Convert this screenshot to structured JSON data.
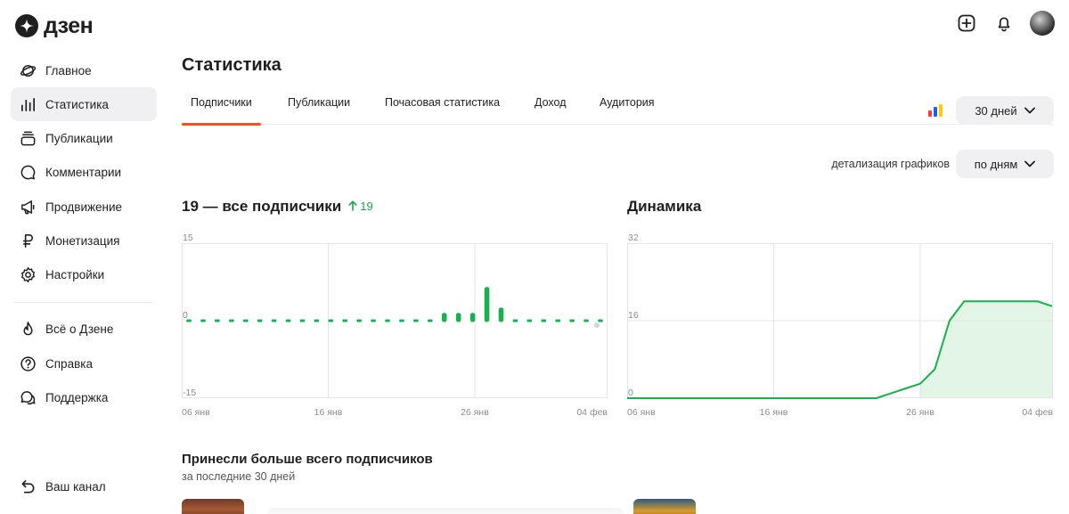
{
  "header": {
    "logo_text": "дзен",
    "icons": {
      "logo": "dzen-star-icon",
      "add": "plus-square-icon",
      "bell": "bell-icon",
      "avatar": "avatar"
    }
  },
  "sidebar": {
    "items": [
      {
        "label": "Главное",
        "icon": "planet-icon"
      },
      {
        "label": "Статистика",
        "icon": "bar-stats-icon",
        "active": true
      },
      {
        "label": "Публикации",
        "icon": "stack-icon"
      },
      {
        "label": "Комментарии",
        "icon": "comment-icon"
      },
      {
        "label": "Продвижение",
        "icon": "megaphone-icon"
      },
      {
        "label": "Монетизация",
        "icon": "ruble-icon"
      },
      {
        "label": "Настройки",
        "icon": "gear-icon"
      }
    ],
    "secondary": [
      {
        "label": "Всё о Дзене",
        "icon": "flame-icon"
      },
      {
        "label": "Справка",
        "icon": "help-icon"
      },
      {
        "label": "Поддержка",
        "icon": "chat-icon"
      }
    ],
    "channel": {
      "label": "Ваш канал",
      "icon": "back-arrow-icon"
    }
  },
  "page": {
    "title": "Статистика",
    "tabs": [
      {
        "label": "Подписчики",
        "active": true
      },
      {
        "label": "Публикации"
      },
      {
        "label": "Почасовая статистика"
      },
      {
        "label": "Доход"
      },
      {
        "label": "Аудитория"
      }
    ],
    "period": {
      "selected": "30 дней"
    },
    "detail": {
      "label": "детализация графиков",
      "selected": "по дням"
    }
  },
  "subscribers": {
    "title": "19 — все подписчики",
    "growth": "19"
  },
  "dynamics": {
    "title": "Динамика"
  },
  "bottom": {
    "title": "Принесли больше всего подписчиков",
    "subtitle": "за последние 30 дней"
  },
  "colors": {
    "accent": "#ff4b1f",
    "green": "#1aa64b",
    "bar": "#16b24b",
    "area": "#e3f5e6",
    "grid": "#e4e4e4"
  },
  "chart_data": [
    {
      "type": "bar",
      "title": "19 — все подписчики",
      "x": [
        "06 янв",
        "07 янв",
        "08 янв",
        "09 янв",
        "10 янв",
        "11 янв",
        "12 янв",
        "13 янв",
        "14 янв",
        "15 янв",
        "16 янв",
        "17 янв",
        "18 янв",
        "19 янв",
        "20 янв",
        "21 янв",
        "22 янв",
        "23 янв",
        "24 янв",
        "25 янв",
        "26 янв",
        "27 янв",
        "28 янв",
        "29 янв",
        "30 янв",
        "31 янв",
        "01 фев",
        "02 фев",
        "03 фев",
        "04 фев"
      ],
      "values": [
        0,
        0,
        0,
        0,
        0,
        0,
        0,
        0,
        0,
        0,
        0,
        0,
        0,
        0,
        0,
        0,
        0,
        0,
        1,
        1,
        1,
        6,
        2,
        0,
        0,
        0,
        0,
        0,
        0,
        0
      ],
      "ylim": [
        -15,
        15
      ],
      "yticks": [
        "15",
        "0",
        "-15"
      ],
      "xticks": [
        "06 янв",
        "16 янв",
        "26 янв",
        "04 фев"
      ]
    },
    {
      "type": "area",
      "title": "Динамика",
      "x": [
        "06 янв",
        "07 янв",
        "08 янв",
        "09 янв",
        "10 янв",
        "11 янв",
        "12 янв",
        "13 янв",
        "14 янв",
        "15 янв",
        "16 янв",
        "17 янв",
        "18 янв",
        "19 янв",
        "20 янв",
        "21 янв",
        "22 янв",
        "23 янв",
        "24 янв",
        "25 янв",
        "26 янв",
        "27 янв",
        "28 янв",
        "29 янв",
        "30 янв",
        "31 янв",
        "01 фев",
        "02 фев",
        "03 фев",
        "04 фев"
      ],
      "values": [
        0,
        0,
        0,
        0,
        0,
        0,
        0,
        0,
        0,
        0,
        0,
        0,
        0,
        0,
        0,
        0,
        0,
        0,
        1,
        2,
        3,
        6,
        16,
        20,
        20,
        20,
        20,
        20,
        20,
        19
      ],
      "ylim": [
        0,
        32
      ],
      "yticks": [
        "32",
        "16",
        "0"
      ],
      "xticks": [
        "06 янв",
        "16 янв",
        "26 янв",
        "04 фев"
      ],
      "shaded_from": "26 янв"
    }
  ]
}
